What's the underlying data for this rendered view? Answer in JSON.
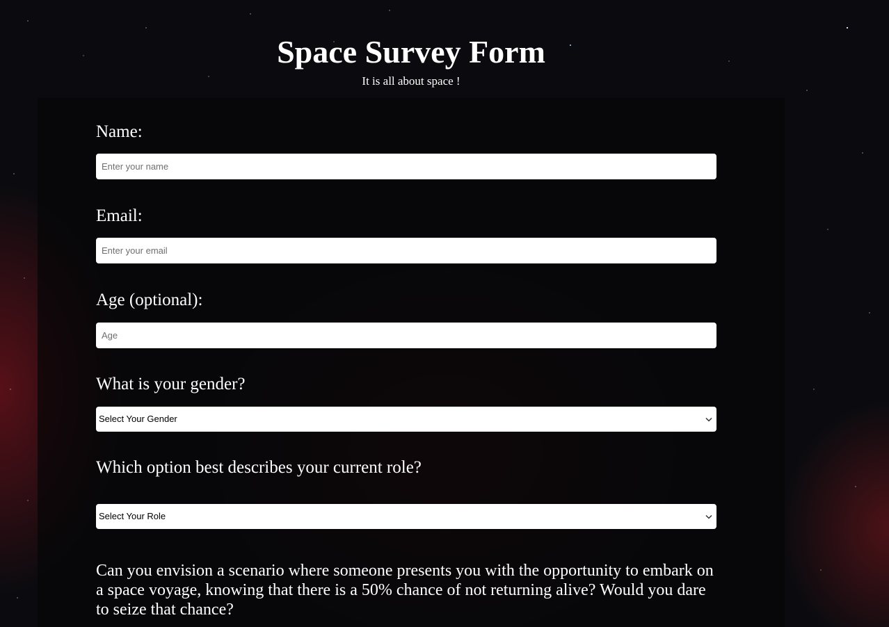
{
  "header": {
    "title": "Space Survey Form",
    "subtitle": "It is all about space !"
  },
  "form": {
    "name": {
      "label": "Name:",
      "placeholder": "Enter your name"
    },
    "email": {
      "label": "Email:",
      "placeholder": "Enter your email"
    },
    "age": {
      "label": "Age (optional):",
      "placeholder": "Age"
    },
    "gender": {
      "label": "What is your gender?",
      "selected": "Select Your Gender",
      "icon": "chevron-down-icon"
    },
    "role": {
      "label": "Which option best describes your current role?",
      "selected": "Select Your Role",
      "icon": "chevron-down-icon"
    },
    "voyage_question": "Can you envision a scenario where someone presents you with the opportunity to embark on a space voyage, knowing that there is a 50% chance of not returning alive? Would you dare to seize that chance?"
  },
  "colors": {
    "text": "#ffffff",
    "card_background": "#050507",
    "input_background": "#ffffff",
    "nebula_accent": "#96141e"
  }
}
